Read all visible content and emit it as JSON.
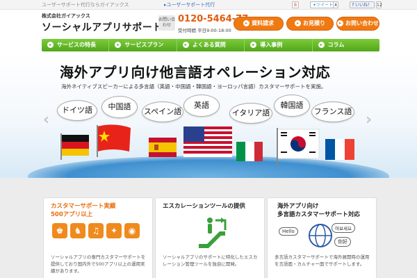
{
  "topbar": {
    "tagline": "ユーザーサポート代行ならガイアックス",
    "crumb": "▸ユーザーサポート代行",
    "tweet_label": "ツイート",
    "tweet_count": "4",
    "facebook_label": "いいね！",
    "facebook_count": "12",
    "social_small": "B"
  },
  "header": {
    "company": "株式会社ガイアックス",
    "site_name": "ソーシャルアプリサポート",
    "contact_badge": "お問い合わせ",
    "phone": "0120-5464-77",
    "hours": "受付時間 平日9:00-18:00",
    "buttons": [
      {
        "label": "資料請求"
      },
      {
        "label": "お見積り"
      },
      {
        "label": "お問い合わせ"
      }
    ]
  },
  "nav": {
    "items": [
      {
        "label": "サービスの特長"
      },
      {
        "label": "サービスプラン"
      },
      {
        "label": "よくある質問"
      },
      {
        "label": "導入事例"
      },
      {
        "label": "コラム"
      }
    ]
  },
  "hero": {
    "title": "海外アプリ向け他言語オペレーション対応",
    "subtitle": "海外ネイティブスピーカーによる多言語（英語・中国語・韓国語・ヨーロッパ言語）カスタマーサポートを実施。",
    "languages": [
      {
        "label": "ドイツ語"
      },
      {
        "label": "中国語"
      },
      {
        "label": "スペイン語"
      },
      {
        "label": "英語"
      },
      {
        "label": "イタリア語"
      },
      {
        "label": "韓国語"
      },
      {
        "label": "フランス語"
      }
    ],
    "prev_arrow": "‹",
    "next_arrow": "›"
  },
  "features": [
    {
      "title_line1": "カスタマーサポート実績",
      "title_line2": "500アプリ以上",
      "desc": "ソーシャルアプリの専門カスタマーサポートを提供しており国内外で500アプリ以上の運用実績があります。"
    },
    {
      "title_line1": "エスカレーションツールの提供",
      "title_line2": "",
      "desc": "ソーシャルアプリのサポートに特化したエスカレーション管理ツールを独自に開発。"
    },
    {
      "title_line1": "海外アプリ向け",
      "title_line2": "多言語カスタマーサポート対応",
      "desc": "多言語カスタマーサポートで海外展開時の運用を言語面・カルチャー面でサポートします。",
      "bubbles": [
        "Hello",
        "여보세요",
        "你好"
      ]
    }
  ],
  "colors": {
    "accent_orange": "#f07a12",
    "nav_green": "#52a61a",
    "phone_orange": "#e45b0c"
  }
}
